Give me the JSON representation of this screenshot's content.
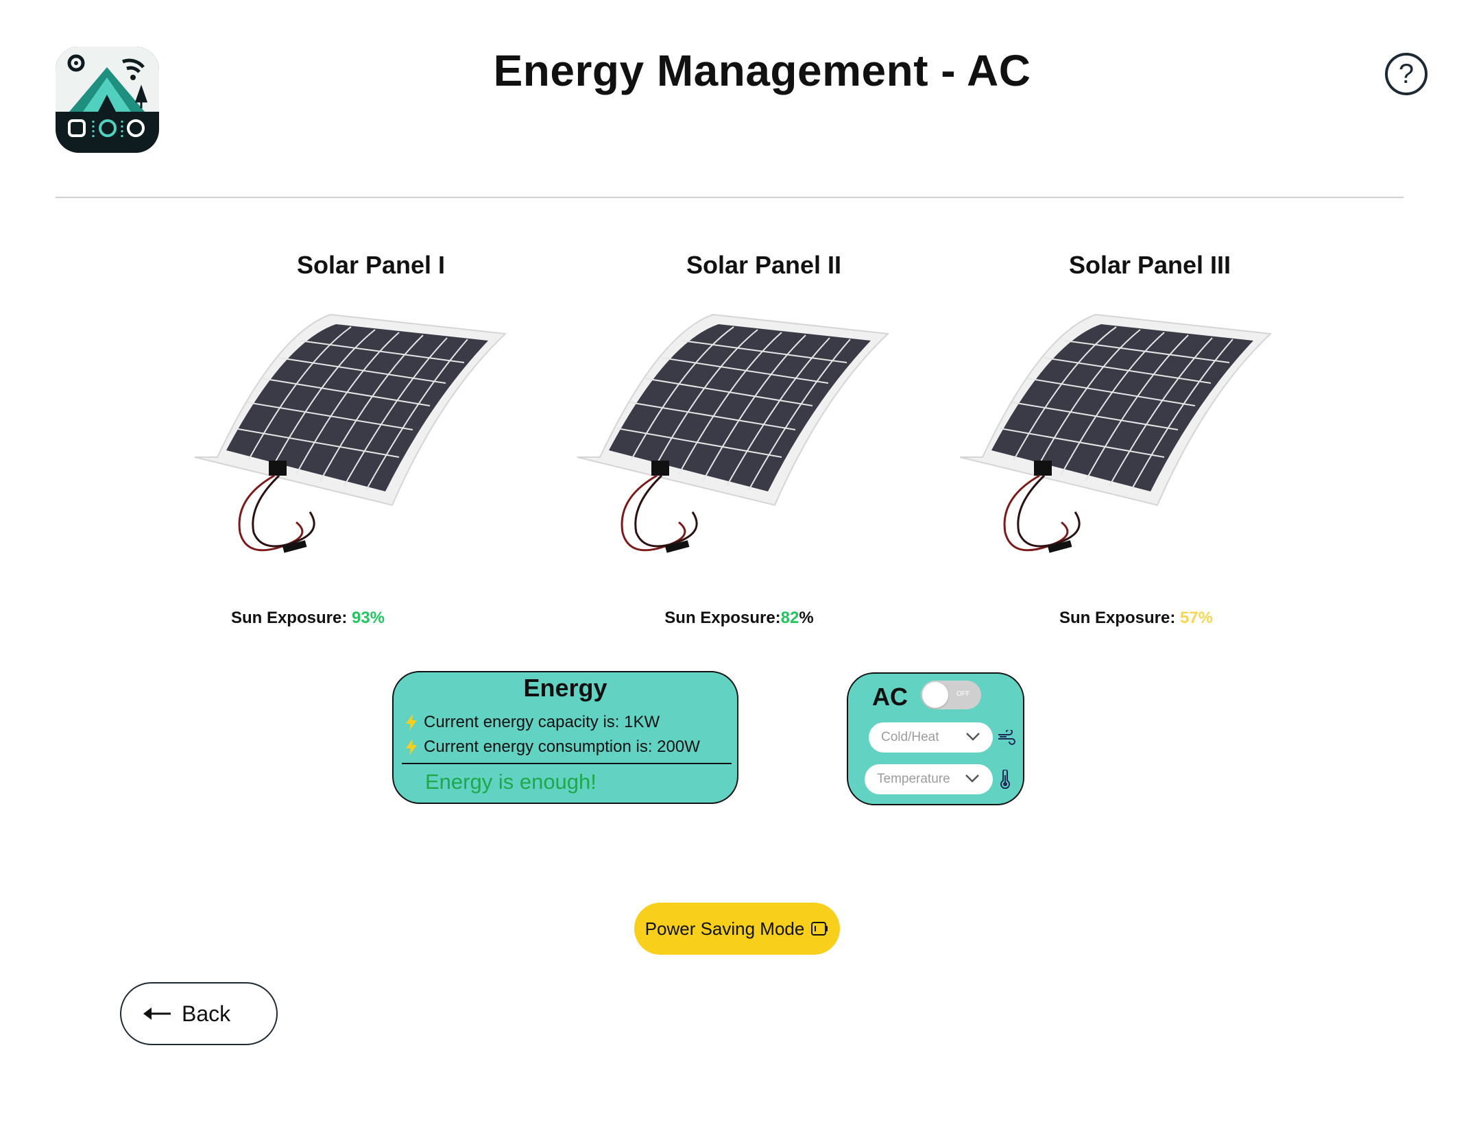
{
  "header": {
    "title": "Energy Management - AC",
    "help_label": "?"
  },
  "panels": [
    {
      "title": "Solar Panel I",
      "exposure_label": "Sun Exposure:",
      "exposure_value": "93%"
    },
    {
      "title": "Solar Panel II",
      "exposure_label": "Sun Exposure:",
      "exposure_value": "82",
      "exposure_suffix": "%"
    },
    {
      "title": "Solar Panel III",
      "exposure_label": "Sun Exposure:",
      "exposure_value": "57%"
    }
  ],
  "energy": {
    "title": "Energy",
    "capacity_text": "Current energy capacity is: 1KW",
    "consumption_text": "Current energy consumption is: 200W",
    "status_text": "Energy is enough!"
  },
  "ac": {
    "title": "AC",
    "toggle_state": "OFF",
    "mode_placeholder": "Cold/Heat",
    "temperature_placeholder": "Temperature"
  },
  "power_saving": {
    "label": "Power Saving Mode"
  },
  "back": {
    "label": "Back"
  },
  "colors": {
    "card": "#62d3c3",
    "accent_yellow": "#f8cf1a",
    "exposure_green": "#22c55e",
    "exposure_yellow": "#f6d653",
    "status_green": "#1ea84a"
  }
}
